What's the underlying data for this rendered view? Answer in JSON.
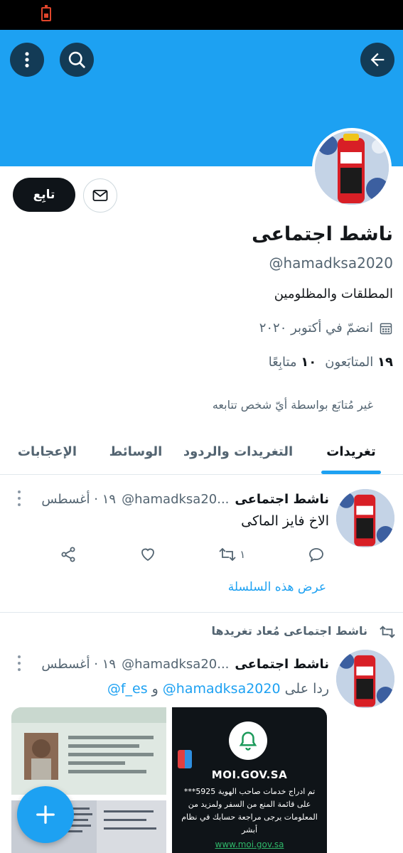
{
  "status_bar": {
    "battery_icon": "battery-charging-icon"
  },
  "header": {
    "back_icon": "arrow-left-icon",
    "search_icon": "search-icon",
    "more_icon": "more-vertical-icon",
    "banner_color": "#1da1f2"
  },
  "profile": {
    "name": "ناشط اجتماعى",
    "handle": "@hamadksa2020",
    "bio": "المطلقات والمظلومين",
    "joined": "انضمّ في أكتوبر ٢٠٢٠",
    "followers_count": "١٩",
    "followers_label": "المتابَعون",
    "following_count": "١٠",
    "following_label": "متابِعًا",
    "not_followed_note": "غير مُتابَع بواسطة أيّ شخص تتابعه",
    "follow_label": "تابِع",
    "message_icon": "envelope-icon",
    "calendar_icon": "calendar-icon"
  },
  "tabs": [
    {
      "label": "تغريدات",
      "active": true
    },
    {
      "label": "التغريدات والردود",
      "active": false
    },
    {
      "label": "الوسائط",
      "active": false
    },
    {
      "label": "الإعجابات",
      "active": false
    }
  ],
  "tweets": [
    {
      "name": "ناشط اجتماعى",
      "handle": "@hamadksa20...",
      "date": "١٩ · أغسطس",
      "text": "الاخ فايز الماكى",
      "reply_count": "",
      "retweet_count": "١",
      "like_count": "",
      "thread_link": "عرض هذه السلسلة"
    },
    {
      "retweeted_by": "ناشط اجتماعى مُعاد تغريدها",
      "name": "ناشط اجتماعى",
      "handle": "@hamadksa20...",
      "date": "١٩ · أغسطس",
      "reply_prefix": "ردا على",
      "reply_mention_1": "@hamadksa2020",
      "reply_joiner": "و",
      "reply_mention_2": "@f_es",
      "media": {
        "moi_title": "MOI.GOV.SA",
        "moi_message": "تم ادراج خدمات صاحب الهوية 5925*** على قائمة المنع من السفر ولمزيد من المعلومات يرجى مراجعة حسابك في نظام أبشر",
        "moi_url": "www.moi.gov.sa",
        "moi_icon": "bell-icon"
      }
    }
  ],
  "fab": {
    "icon": "plus-icon"
  }
}
